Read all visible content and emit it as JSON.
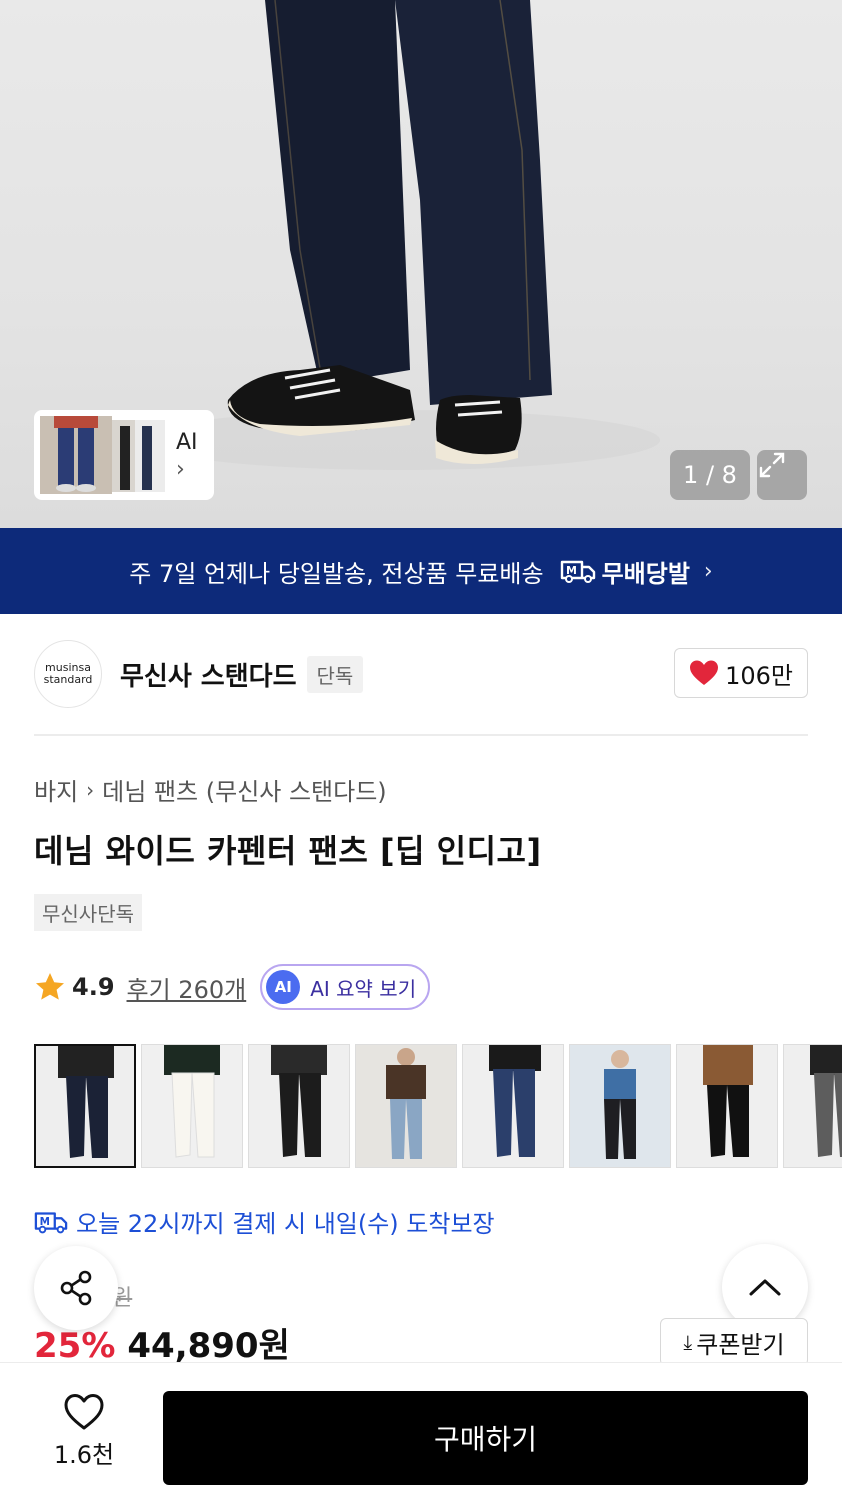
{
  "gallery": {
    "ai_label": "AI",
    "counter": "1 / 8"
  },
  "banner": {
    "text": "주 7일 언제나 당일발송, 전상품 무료배송",
    "brand": "무배당발"
  },
  "brand": {
    "logo_line1": "musinsa",
    "logo_line2": "standard",
    "name": "무신사 스탠다드",
    "badge": "단독",
    "likes": "106만"
  },
  "breadcrumb": {
    "items": [
      "바지",
      "데님 팬츠 (무신사 스탠다드)"
    ]
  },
  "product": {
    "title": "데님 와이드 카펜터 팬츠 [딥 인디고]",
    "tag": "무신사단독",
    "rating": "4.9",
    "reviews": "후기 260개",
    "ai_summary_badge": "AI",
    "ai_summary": "AI 요약 보기",
    "delivery": "오늘 22시까지 결제 시 내일(수) 도착보장",
    "original_price_partial": "원",
    "discount": "25%",
    "price": "44,890원"
  },
  "colors": {
    "variants": [
      "#1b2236",
      "#f4f1ea",
      "#1c1c1c",
      "#8aa6c4",
      "#2b3f6b",
      "#1e1e22",
      "#111111",
      "#5d5d5d"
    ]
  },
  "actions": {
    "coupon": "쿠폰받기",
    "wish_count": "1.6천",
    "buy": "구매하기"
  },
  "theme": {
    "banner_bg": "#0d2a7a",
    "discount": "#e2263b",
    "delivery": "#1d4fd6",
    "heart": "#e2263b"
  }
}
